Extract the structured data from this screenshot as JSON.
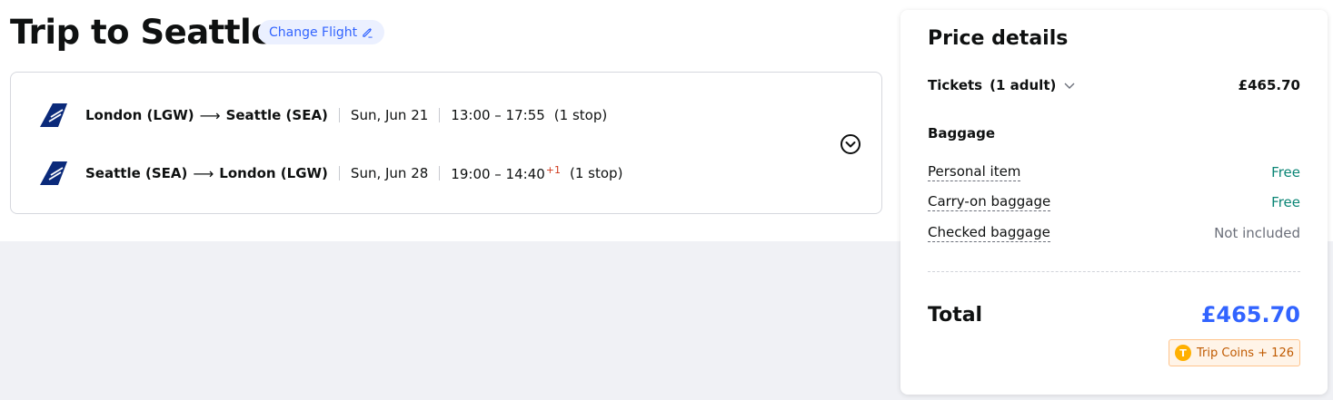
{
  "trip": {
    "title": "Trip to Seattle",
    "change_flight_label": "Change Flight"
  },
  "flights": {
    "outbound": {
      "from": "London (LGW)",
      "to": "Seattle (SEA)",
      "date": "Sun, Jun 21",
      "times": "13:00 – 17:55",
      "day_offset": "",
      "stops": "(1 stop)"
    },
    "inbound": {
      "from": "Seattle (SEA)",
      "to": "London (LGW)",
      "date": "Sun, Jun 28",
      "times": "19:00 – 14:40",
      "day_offset": "+1",
      "stops": "(1 stop)"
    },
    "airline_icon": "airline-tail-logo-icon",
    "airline_color": "#0b2a7a",
    "expand_icon": "chevron-down-circle-icon"
  },
  "price_details": {
    "title": "Price details",
    "tickets_label": "Tickets",
    "tickets_pax": "(1 adult)",
    "tickets_price": "£465.70",
    "baggage_heading": "Baggage",
    "baggage": [
      {
        "name": "Personal item",
        "value": "Free"
      },
      {
        "name": "Carry-on baggage",
        "value": "Free"
      },
      {
        "name": "Checked baggage",
        "value": "Not included"
      }
    ],
    "total_label": "Total",
    "total_price": "£465.70",
    "coins_label": "Trip Coins + 126",
    "coin_letter": "T",
    "accent_color": "#3264ff",
    "free_color": "#0a8575"
  }
}
